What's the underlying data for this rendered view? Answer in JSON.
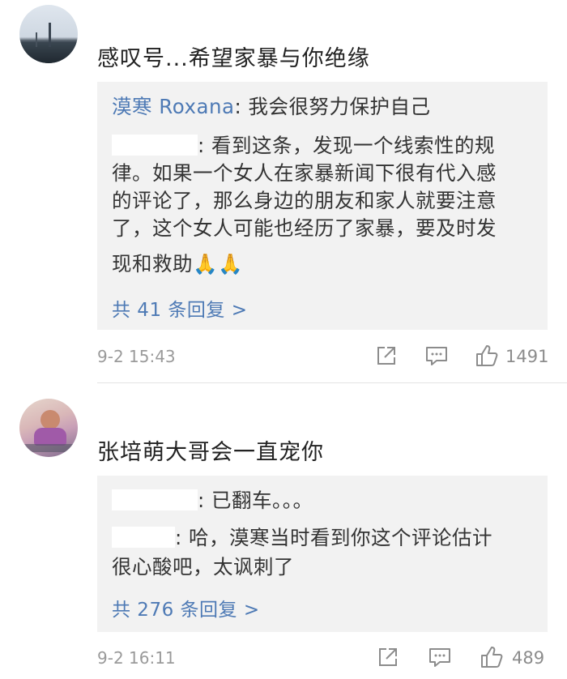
{
  "comments": [
    {
      "text": "感叹号...希望家暴与你绝缘",
      "replies": [
        {
          "name": "漠寒 Roxana",
          "sep": ": ",
          "text": "我会很努力保护自己"
        },
        {
          "lines": [
            ": 看到这条，发现一个线索性的规",
            "律。如果一个女人在家暴新闻下很有代入感",
            "的评论了，那么身边的朋友和家人就要注意",
            "了，这个女人可能也经历了家暴，要及时发",
            "现和救助🙏🙏"
          ]
        }
      ],
      "more_label": "共 41 条回复 >",
      "time": "9-2 15:43",
      "likes": "1491"
    },
    {
      "text": "张培萌大哥会一直宠你",
      "replies": [
        {
          "text": ": 已翻车。。。"
        },
        {
          "lines": [
            ": 哈，漠寒当时看到你这个评论估计",
            "很心酸吧，太讽刺了"
          ]
        }
      ],
      "more_label": "共 276 条回复 >",
      "time": "9-2 16:11",
      "likes": "489"
    }
  ],
  "icons": [
    "share-icon",
    "comment-icon",
    "like-icon"
  ],
  "colors": {
    "link": "#4e7ab5",
    "reply_bg": "#f2f2f2",
    "meta": "#9a9a9a"
  }
}
